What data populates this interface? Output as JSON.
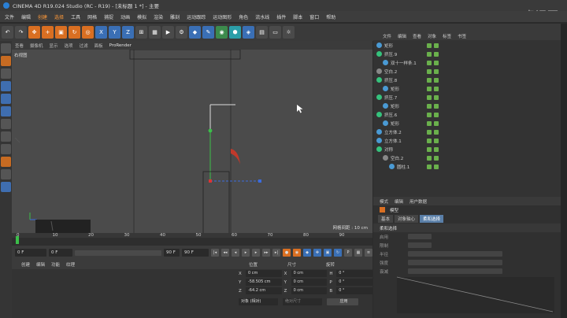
{
  "window": {
    "title": "CINEMA 4D R19.024 Studio (RC - R19) - [未标题 1 *] - 主要"
  },
  "menu": [
    "文件",
    "编辑",
    "创建",
    "选择",
    "工具",
    "网格",
    "捕捉",
    "动画",
    "模拟",
    "渲染",
    "雕刻",
    "运动跟踪",
    "运动图形",
    "角色",
    "流水线",
    "插件",
    "脚本",
    "窗口",
    "帮助"
  ],
  "menu_highlight": [
    "创建",
    "选择"
  ],
  "watermark": "虎课网",
  "viewport": {
    "menu": [
      "查看",
      "摄像机",
      "显示",
      "选项",
      "过滤",
      "面板",
      "ProRender"
    ],
    "label": "右视图",
    "grid_label": "网格间距 : 10 cm"
  },
  "timeline": {
    "ticks": [
      "0",
      "10",
      "20",
      "30",
      "40",
      "50",
      "60",
      "70",
      "80",
      "90"
    ],
    "marker": "0 F"
  },
  "transport": {
    "start": "0 F",
    "current": "0 F",
    "end": "90 F",
    "end2": "90 F",
    "range": "90 F"
  },
  "material": {
    "menu": [
      "创建",
      "编辑",
      "功能",
      "纹理"
    ]
  },
  "coords": {
    "headers": [
      "位置",
      "尺寸",
      "旋转"
    ],
    "rows": [
      {
        "axis": "X",
        "pos": "0 cm",
        "size": "0 cm",
        "rot_label": "H",
        "rot": "0 °"
      },
      {
        "axis": "Y",
        "pos": "-58.505 cm",
        "size": "0 cm",
        "rot_label": "P",
        "rot": "0 °"
      },
      {
        "axis": "Z",
        "pos": "-64.2 cm",
        "size": "0 cm",
        "rot_label": "B",
        "rot": "0 °"
      }
    ],
    "mode": "对象 (相对)",
    "size_mode": "绝对尺寸",
    "apply": "应用"
  },
  "objects": {
    "tabs": [
      "文件",
      "编辑",
      "查看",
      "对象",
      "标签",
      "书签"
    ],
    "items": [
      {
        "name": "矩形",
        "indent": 0,
        "color": "#4a9ad4"
      },
      {
        "name": "挤压.9",
        "indent": 0,
        "color": "#35c27c"
      },
      {
        "name": "双十一样条.1",
        "indent": 1,
        "color": "#4a9ad4"
      },
      {
        "name": "空白.2",
        "indent": 0,
        "color": "#888"
      },
      {
        "name": "挤压.8",
        "indent": 0,
        "color": "#35c27c"
      },
      {
        "name": "矩形",
        "indent": 1,
        "color": "#4a9ad4"
      },
      {
        "name": "挤压.7",
        "indent": 0,
        "color": "#35c27c"
      },
      {
        "name": "矩形",
        "indent": 1,
        "color": "#4a9ad4"
      },
      {
        "name": "挤压.6",
        "indent": 0,
        "color": "#35c27c"
      },
      {
        "name": "矩形",
        "indent": 1,
        "color": "#4a9ad4"
      },
      {
        "name": "立方体.2",
        "indent": 0,
        "color": "#4a9ad4"
      },
      {
        "name": "立方体.1",
        "indent": 0,
        "color": "#4a9ad4"
      },
      {
        "name": "对称",
        "indent": 0,
        "color": "#35c27c"
      },
      {
        "name": "空白.2",
        "indent": 1,
        "color": "#888"
      },
      {
        "name": "圆柱.1",
        "indent": 2,
        "color": "#4a9ad4"
      }
    ]
  },
  "attributes": {
    "tabs": [
      "模式",
      "编辑",
      "用户数据"
    ],
    "object_name": "模型",
    "subtabs": [
      "基本",
      "对象轴心",
      "柔和选择"
    ],
    "section": "柔和选择",
    "rows": [
      "启用",
      "限制",
      "半径",
      "强度",
      "衰减"
    ]
  }
}
